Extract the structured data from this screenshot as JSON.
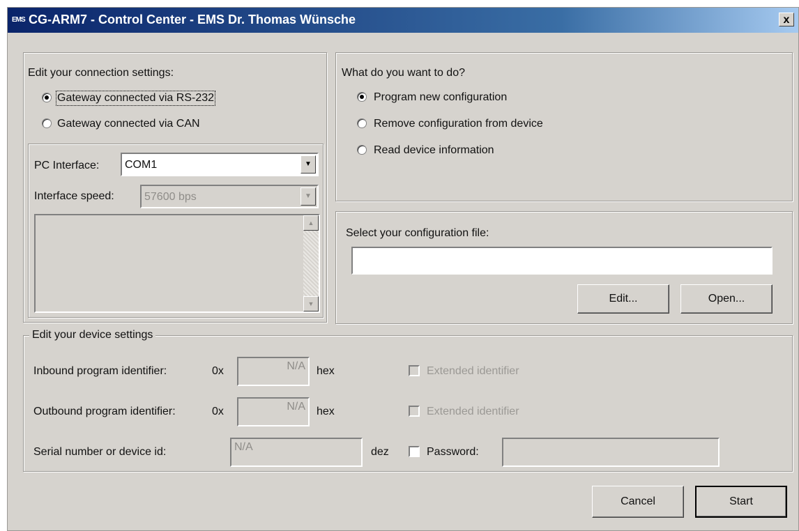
{
  "window": {
    "title": "CG-ARM7 - Control Center - EMS Dr. Thomas Wünsche",
    "icon_text": "EMS",
    "close_label": "x"
  },
  "connection": {
    "heading": "Edit your connection settings:",
    "options": [
      "Gateway connected via RS-232",
      "Gateway connected via CAN"
    ],
    "selected": 0,
    "pc_interface_label": "PC Interface:",
    "pc_interface_value": "COM1",
    "speed_label": "Interface speed:",
    "speed_value": "57600 bps"
  },
  "action": {
    "heading": "What do you want to do?",
    "options": [
      "Program new configuration",
      "Remove configuration from device",
      "Read device information"
    ],
    "selected": 0
  },
  "config": {
    "heading": "Select your configuration file:",
    "file_value": "",
    "edit_button": "Edit...",
    "open_button": "Open..."
  },
  "device": {
    "legend": "Edit your device settings",
    "inbound_label": "Inbound program identifier:",
    "inbound_prefix": "0x",
    "inbound_value": "N/A",
    "inbound_unit": "hex",
    "inbound_ext_label": "Extended identifier",
    "outbound_label": "Outbound program identifier:",
    "outbound_prefix": "0x",
    "outbound_value": "N/A",
    "outbound_unit": "hex",
    "outbound_ext_label": "Extended identifier",
    "serial_label": "Serial number or device id:",
    "serial_value": "N/A",
    "serial_unit": "dez",
    "password_label": "Password:",
    "password_value": ""
  },
  "footer": {
    "cancel_button": "Cancel",
    "start_button": "Start"
  }
}
